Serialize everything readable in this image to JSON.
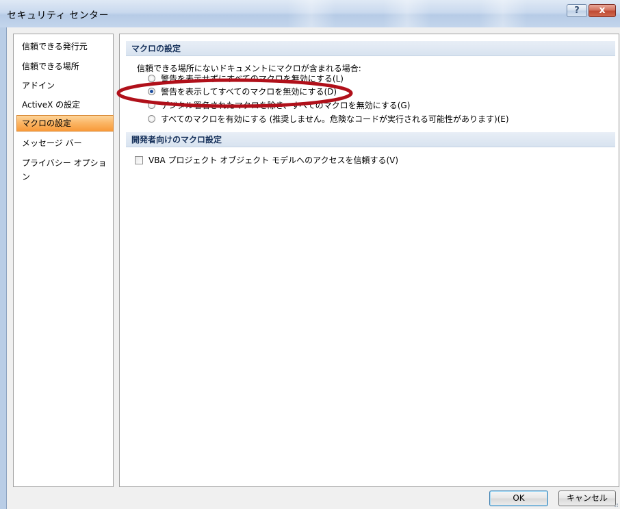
{
  "window": {
    "title": "セキュリティ センター",
    "help_label": "?",
    "close_label": "x"
  },
  "sidebar": {
    "items": [
      {
        "label": "信頼できる発行元"
      },
      {
        "label": "信頼できる場所"
      },
      {
        "label": "アドイン"
      },
      {
        "label": "ActiveX の設定"
      },
      {
        "label": "マクロの設定"
      },
      {
        "label": "メッセージ バー"
      },
      {
        "label": "プライバシー オプション"
      }
    ],
    "selected": "マクロの設定"
  },
  "macro_settings": {
    "header": "マクロの設定",
    "description": "信頼できる場所にないドキュメントにマクロが含まれる場合:",
    "options": [
      {
        "label": "警告を表示せずにすべてのマクロを無効にする(L)",
        "checked": false
      },
      {
        "label": "警告を表示してすべてのマクロを無効にする(D)",
        "checked": true
      },
      {
        "label": "デジタル署名されたマクロを除き、すべてのマクロを無効にする(G)",
        "checked": false
      },
      {
        "label": "すべてのマクロを有効にする (推奨しません。危険なコードが実行される可能性があります)(E)",
        "checked": false
      }
    ]
  },
  "developer_settings": {
    "header": "開発者向けのマクロ設定",
    "trust_vba_label": "VBA プロジェクト オブジェクト モデルへのアクセスを信頼する(V)",
    "trust_vba_checked": false
  },
  "buttons": {
    "ok_label": "OK",
    "cancel_label": "キャンセル"
  },
  "colors": {
    "selected_item": "#fbb463",
    "section_header_text": "#15305a",
    "annotation_ellipse": "#b0101a"
  }
}
